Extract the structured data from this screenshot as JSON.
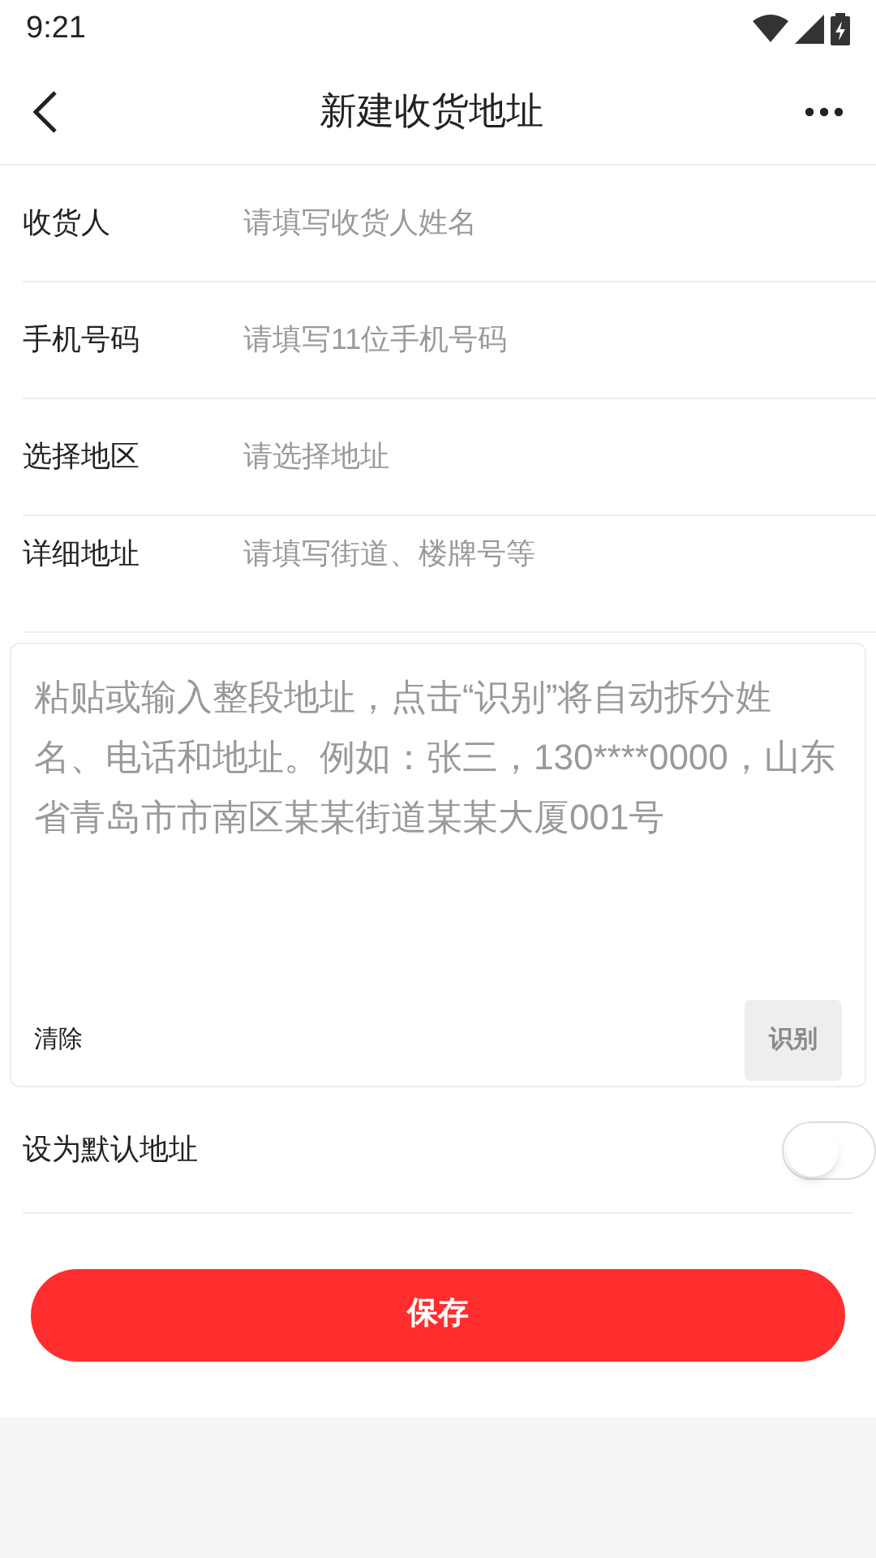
{
  "status_bar": {
    "time": "9:21"
  },
  "header": {
    "title": "新建收货地址"
  },
  "fields": [
    {
      "label": "收货人",
      "placeholder": "请填写收货人姓名"
    },
    {
      "label": "手机号码",
      "placeholder": "请填写11位手机号码"
    },
    {
      "label": "选择地区",
      "placeholder": "请选择地址"
    },
    {
      "label": "详细地址",
      "placeholder": "请填写街道、楼牌号等"
    }
  ],
  "smart_paste": {
    "placeholder": "粘贴或输入整段地址，点击“识别”将自动拆分姓名、电话和地址。例如：张三，130****0000，山东省青岛市市南区某某街道某某大厦001号",
    "clear": "清除",
    "recognize": {
      "label": "识别",
      "disabled": true
    }
  },
  "default_address": {
    "label": "设为默认地址",
    "on": false
  },
  "save_button": "保存"
}
